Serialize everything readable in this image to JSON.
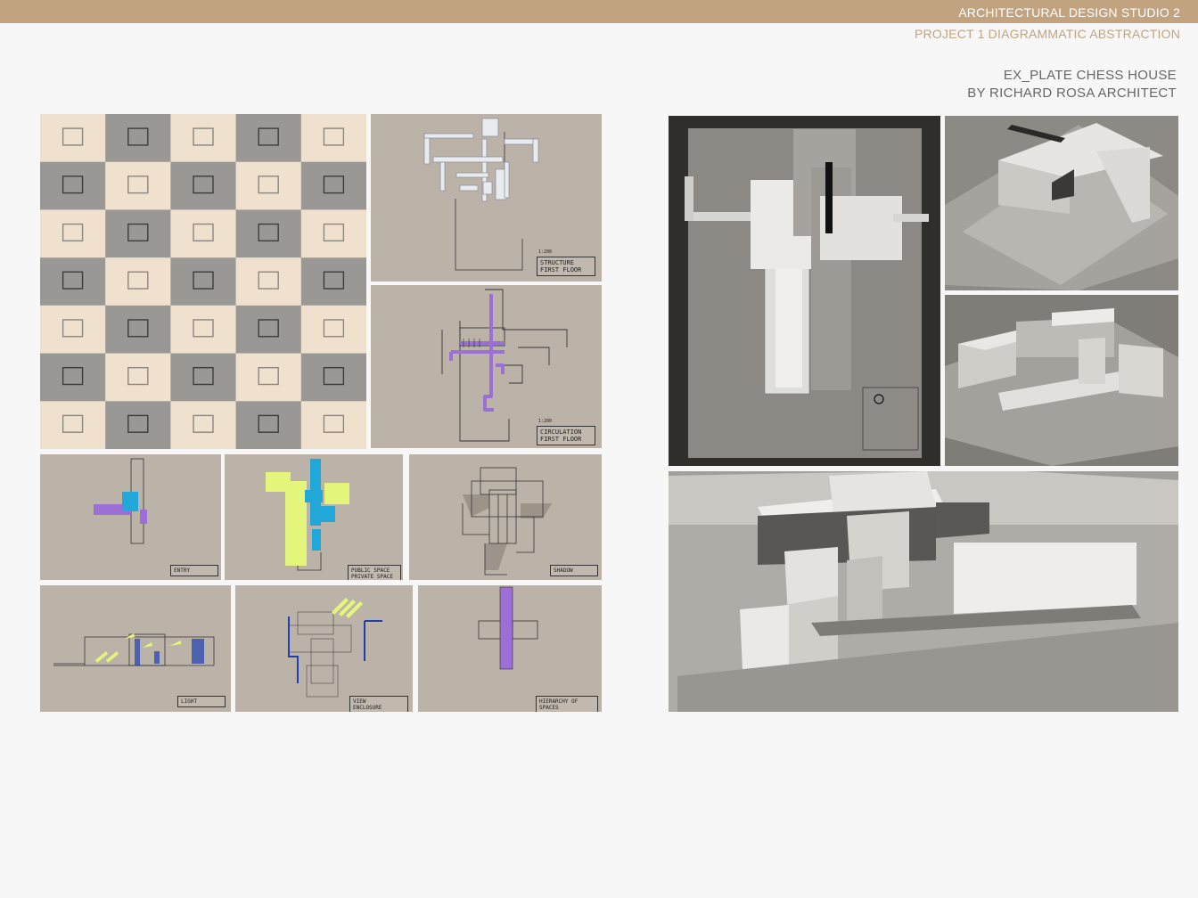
{
  "header": {
    "studio": "ARCHITECTURAL DESIGN STUDIO 2",
    "project": "PROJECT 1  DIAGRAMMATIC ABSTRACTION",
    "subject_line1": "EX_PLATE CHESS HOUSE",
    "subject_line2": "BY RICHARD ROSA ARCHITECT"
  },
  "diagrams": {
    "structure": {
      "scale": "1:200",
      "line1": "STRUCTURE",
      "line2": "FIRST FLOOR"
    },
    "circulation": {
      "scale": "1:200",
      "line1": "CIRCULATION",
      "line2": "FIRST FLOOR"
    },
    "zoning": {
      "scale": "1:200",
      "line1": "ENTRY",
      "line2": ""
    },
    "public_private": {
      "scale": "1:200",
      "line1": "PUBLIC SPACE",
      "line2": "PRIVATE SPACE"
    },
    "shadow": {
      "scale": "1:200",
      "line1": "SHADOW",
      "line2": ""
    },
    "light": {
      "scale": "1:200",
      "line1": "LIGHT",
      "line2": ""
    },
    "view": {
      "scale": "1:200",
      "line1": "VIEW",
      "line2": "ENCLOSURE"
    },
    "hierarchy": {
      "scale": "1:200",
      "line1": "HIERARCHY OF SPACES",
      "line2": ""
    }
  },
  "colors": {
    "header_bar": "#c2a37f",
    "mdf_board": "#bcb3a8",
    "purple": "#9b6fd6",
    "cyan": "#21a8d8",
    "lime": "#e3f57a",
    "blue": "#1f3fb0"
  }
}
